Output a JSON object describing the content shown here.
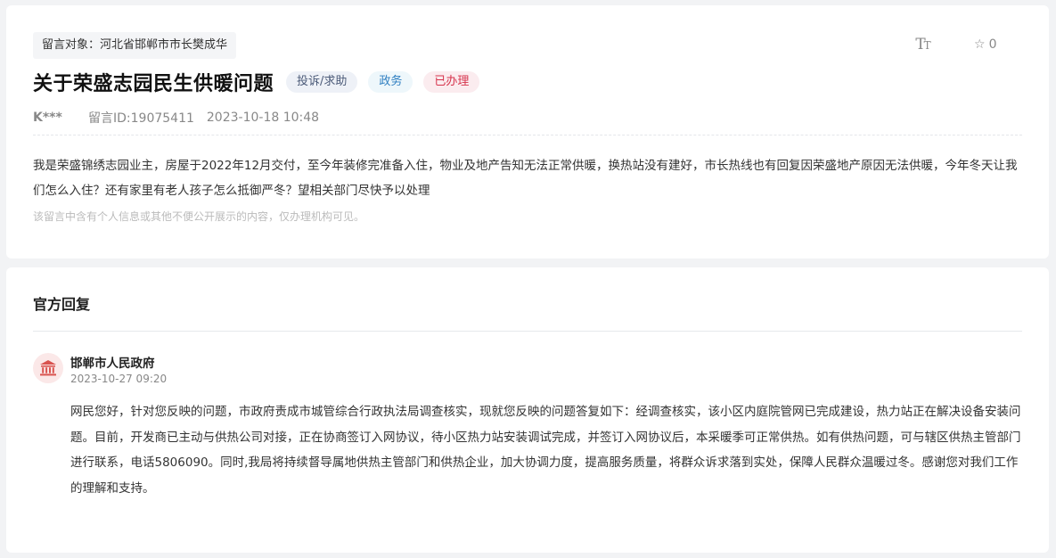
{
  "message": {
    "target": "留言对象：河北省邯郸市市长樊成华",
    "title": "关于荣盛志园民生供暖问题",
    "tags": {
      "type": "投诉/求助",
      "domain": "政务",
      "status": "已办理"
    },
    "author": "K***",
    "message_id": "留言ID:19075411",
    "datetime": "2023-10-18 10:48",
    "content": "我是荣盛锦绣志园业主，房屋于2022年12月交付，至今年装修完准备入住，物业及地产告知无法正常供暖，换热站没有建好，市长热线也有回复因荣盛地产原因无法供暖，今年冬天让我们怎么入住？还有家里有老人孩子怎么抵御严冬？望相关部门尽快予以处理",
    "privacy_notice": "该留言中含有个人信息或其他不便公开展示的内容，仅办理机构可见。",
    "favorite_count": "0"
  },
  "icons": {
    "font_size": "font-size-icon",
    "favorite": "star-outline-icon",
    "org_avatar": "government-building-icon"
  },
  "reply": {
    "section_title": "官方回复",
    "org_name": "邯郸市人民政府",
    "datetime": "2023-10-27 09:20",
    "content": "网民您好，针对您反映的问题，市政府责成市城管综合行政执法局调查核实，现就您反映的问题答复如下：经调查核实，该小区内庭院管网已完成建设，热力站正在解决设备安装问题。目前，开发商已主动与供热公司对接，正在协商签订入网协议，待小区热力站安装调试完成，并签订入网协议后，本采暖季可正常供热。如有供热问题，可与辖区供热主管部门进行联系，电话5806090。同时,我局将持续督导属地供热主管部门和供热企业，加大协调力度，提高服务质量，将群众诉求落到实处，保障人民群众温暖过冬。感谢您对我们工作的理解和支持。"
  },
  "colors": {
    "page_bg": "#f2f3f5",
    "status_red": "#d6344d",
    "domain_blue": "#2f7fc1",
    "avatar_red": "#d9534f"
  }
}
